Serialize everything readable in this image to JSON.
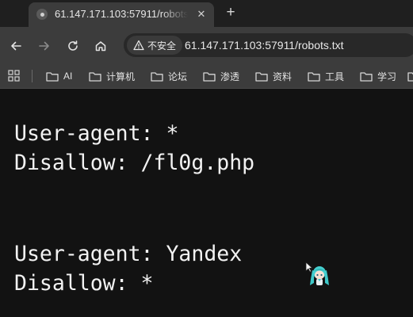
{
  "tab": {
    "title": "61.147.171.103:57911/robots.txt",
    "close_glyph": "✕"
  },
  "new_tab_glyph": "+",
  "address_bar": {
    "security_label": "不安全",
    "url": "61.147.171.103:57911/robots.txt"
  },
  "bookmarks": [
    "AI",
    "计算机",
    "论坛",
    "渗透",
    "资料",
    "工具",
    "学习"
  ],
  "robots_lines": [
    "User-agent: *",
    "Disallow: /fl0g.php",
    "User-agent: Yandex",
    "Disallow: *"
  ],
  "colors": {
    "tab_strip": "#1f1f1f",
    "toolbar": "#3c3c3c",
    "page_background": "#121212",
    "text": "#f2f2f2"
  }
}
